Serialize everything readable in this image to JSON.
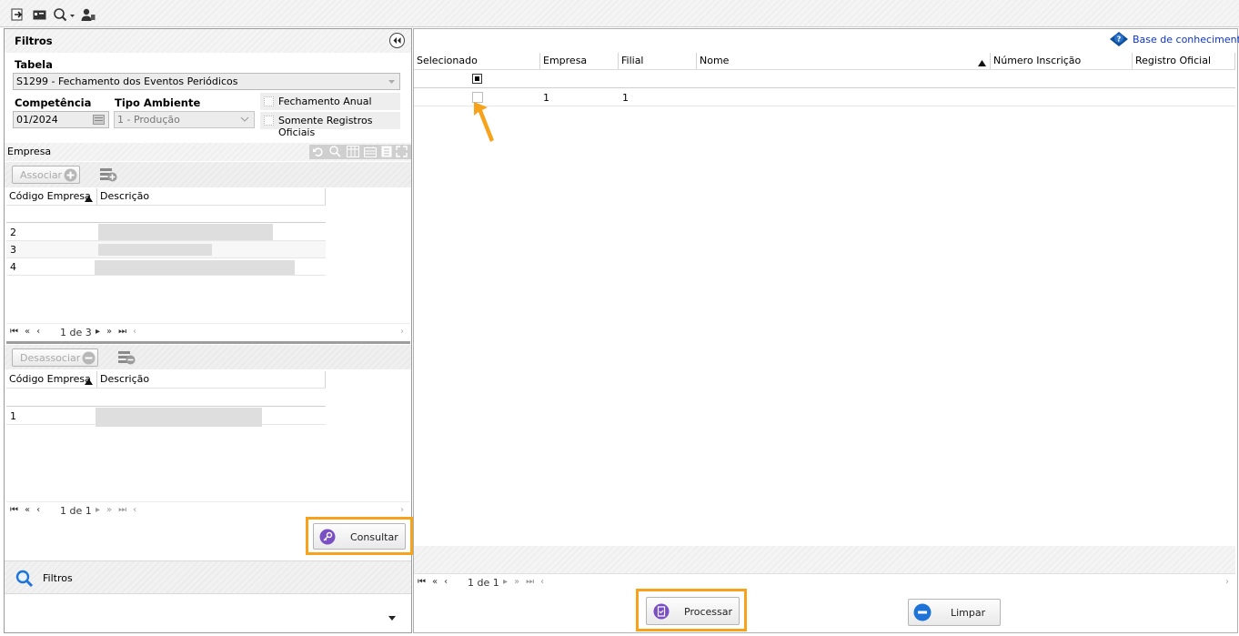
{
  "toolbar": {
    "icons": [
      "exit-icon",
      "card-icon",
      "search-icon",
      "user-icon"
    ]
  },
  "filters_panel": {
    "title": "Filtros",
    "tabela": {
      "label": "Tabela",
      "value": "S1299 - Fechamento dos Eventos Periódicos"
    },
    "competencia": {
      "label": "Competência",
      "value": "01/2024"
    },
    "tipo_ambiente": {
      "label": "Tipo Ambiente",
      "value": "1 - Produção"
    },
    "fechamento_anual": {
      "label": "Fechamento Anual",
      "checked": false
    },
    "somente_registros": {
      "label": "Somente Registros Oficiais",
      "checked": false
    },
    "empresa_section": {
      "label": "Empresa"
    },
    "associar_button": "Associar",
    "available_grid": {
      "columns": [
        "Código Empresa",
        "Descrição"
      ],
      "rows": [
        {
          "code": "2"
        },
        {
          "code": "3"
        },
        {
          "code": "4"
        }
      ],
      "pager": {
        "text": "1 de 3"
      }
    },
    "desassociar_button": "Desassociar",
    "associated_grid": {
      "columns": [
        "Código Empresa",
        "Descrição"
      ],
      "rows": [
        {
          "code": "1"
        }
      ],
      "pager": {
        "text": "1 de 1"
      }
    },
    "consultar_button": "Consultar",
    "bottom_nav": {
      "label": "Filtros"
    }
  },
  "main": {
    "knowledge_link": "Base de conhecimento",
    "columns": [
      "Selecionado",
      "Empresa",
      "Filial",
      "Nome",
      "Número Inscrição",
      "Registro Oficial"
    ],
    "rows": [
      {
        "empresa": "1",
        "filial": "1",
        "nome": "",
        "numero_inscricao": "",
        "registro_oficial": ""
      }
    ],
    "pager": {
      "text": "1 de 1"
    },
    "processar_button": "Processar",
    "limpar_button": "Limpar"
  },
  "colors": {
    "highlight": "#f7a21b",
    "link": "#0b36c9",
    "purple": "#7b4fc4",
    "blue": "#1e73d8"
  }
}
